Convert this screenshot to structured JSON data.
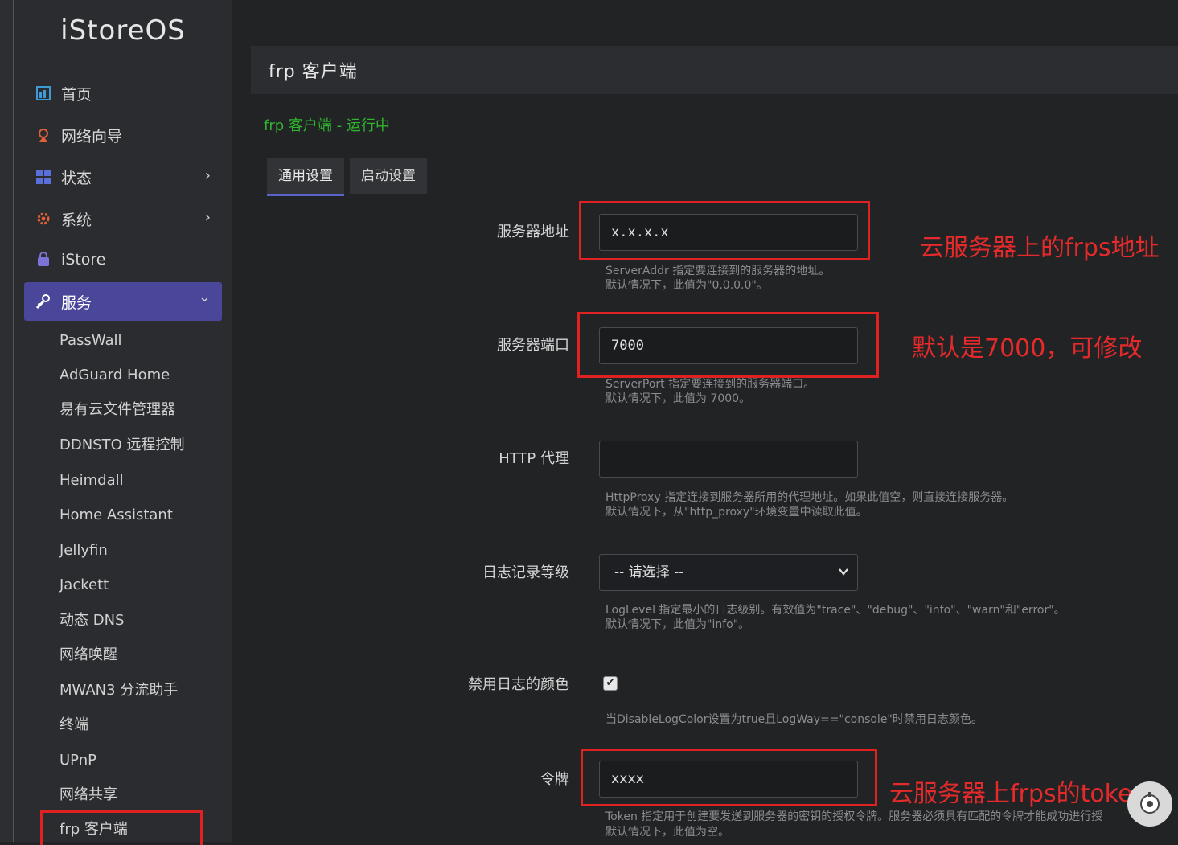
{
  "app": {
    "brand": "iStoreOS"
  },
  "sidebar": {
    "items": [
      {
        "label": "首页",
        "icon": "dashboard-icon",
        "color": "#3f9bd6"
      },
      {
        "label": "网络向导",
        "icon": "wizard-icon",
        "color": "#e0603a"
      },
      {
        "label": "状态",
        "icon": "status-grid-icon",
        "color": "#5b6fd8",
        "chevron": "›"
      },
      {
        "label": "系统",
        "icon": "gear-icon",
        "color": "#e0603a",
        "chevron": "›"
      },
      {
        "label": "iStore",
        "icon": "store-bag-icon",
        "color": "#7b73d6"
      },
      {
        "label": "服务",
        "icon": "services-icon",
        "color": "#ffffff",
        "chevron": "⌄",
        "active": true
      }
    ],
    "sub_items": [
      "PassWall",
      "AdGuard Home",
      "易有云文件管理器",
      "DDNSTO 远程控制",
      "Heimdall",
      "Home Assistant",
      "Jellyfin",
      "Jackett",
      "动态 DNS",
      "网络唤醒",
      "MWAN3 分流助手",
      "终端",
      "UPnP",
      "网络共享",
      "frp 客户端"
    ]
  },
  "page": {
    "title": "frp 客户端",
    "status": "frp 客户端 - 运行中",
    "tabs": [
      "通用设置",
      "启动设置"
    ]
  },
  "form": {
    "server_addr": {
      "label": "服务器地址",
      "value": "x.x.x.x",
      "hint1": "ServerAddr 指定要连接到的服务器的地址。",
      "hint2": "默认情况下，此值为\"0.0.0.0\"。"
    },
    "server_port": {
      "label": "服务器端口",
      "value": "7000",
      "hint1": "ServerPort 指定要连接到的服务器端口。",
      "hint2": "默认情况下，此值为 7000。"
    },
    "http_proxy": {
      "label": "HTTP 代理",
      "value": "",
      "hint1": "HttpProxy 指定连接到服务器所用的代理地址。如果此值空，则直接连接服务器。",
      "hint2": "默认情况下，从\"http_proxy\"环境变量中读取此值。"
    },
    "log_level": {
      "label": "日志记录等级",
      "value": "-- 请选择 --",
      "hint1": "LogLevel 指定最小的日志级别。有效值为\"trace\"、\"debug\"、\"info\"、\"warn\"和\"error\"。",
      "hint2": "默认情况下，此值为\"info\"。"
    },
    "disable_log_color": {
      "label": "禁用日志的颜色",
      "checked": true,
      "check_glyph": "✔",
      "hint1": "当DisableLogColor设置为true且LogWay==\"console\"时禁用日志颜色。"
    },
    "token": {
      "label": "令牌",
      "value": "xxxx",
      "hint1": "Token 指定用于创建要发送到服务器的密钥的授权令牌。服务器必须具有匹配的令牌才能成功进行授",
      "hint2": "默认情况下，此值为空。"
    }
  },
  "annotations": {
    "addr": "云服务器上的frps地址",
    "port": "默认是7000，可修改",
    "token": "云服务器上frps的token"
  },
  "colors": {
    "accent": "#4a469a",
    "status_green": "#2fb52f",
    "annotation_red": "#e42a2a"
  }
}
